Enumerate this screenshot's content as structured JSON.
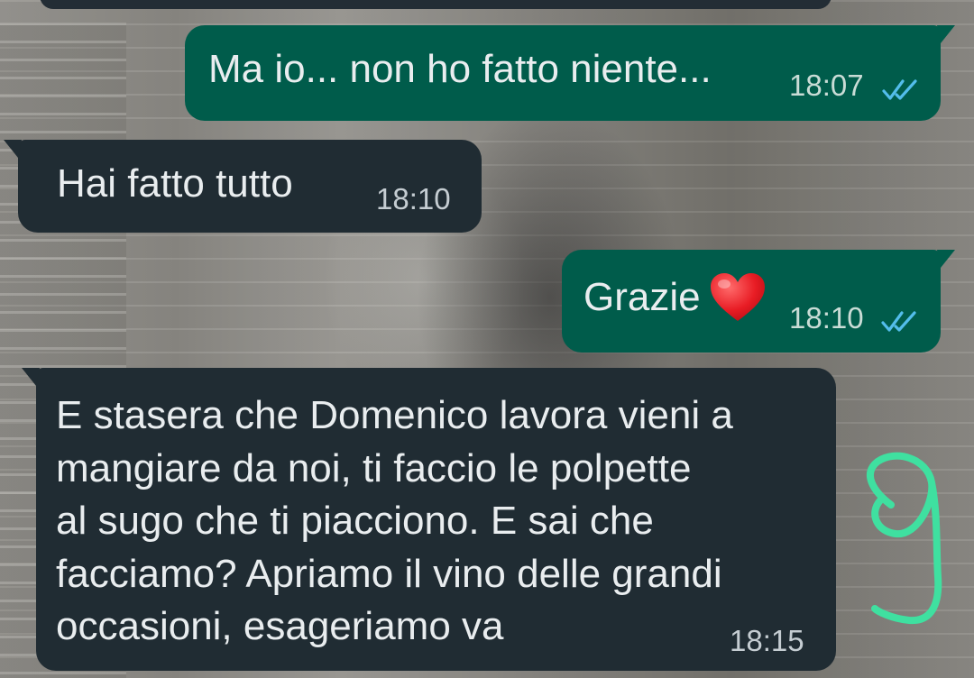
{
  "colors": {
    "outgoing_bubble": "#005c4b",
    "incoming_bubble": "#202c33",
    "read_ticks": "#53bdeb",
    "scribble": "#3fe0a0"
  },
  "messages": [
    {
      "direction": "outgoing",
      "text": "Ma io... non ho fatto niente...",
      "time": "18:07",
      "status": "read-double-check-icon"
    },
    {
      "direction": "incoming",
      "text": "Hai fatto tutto",
      "time": "18:10"
    },
    {
      "direction": "outgoing",
      "text": "Grazie",
      "emoji": "red-heart-icon",
      "time": "18:10",
      "status": "read-double-check-icon"
    },
    {
      "direction": "incoming",
      "lines": [
        "E stasera che Domenico lavora vieni a",
        "mangiare da noi, ti faccio le polpette",
        "al sugo che ti piacciono. E sai che",
        "facciamo? Apriamo il vino delle grandi",
        "occasioni, esageriamo va"
      ],
      "time": "18:15"
    }
  ],
  "annotation": {
    "icon": "handwritten-scribble-icon"
  }
}
